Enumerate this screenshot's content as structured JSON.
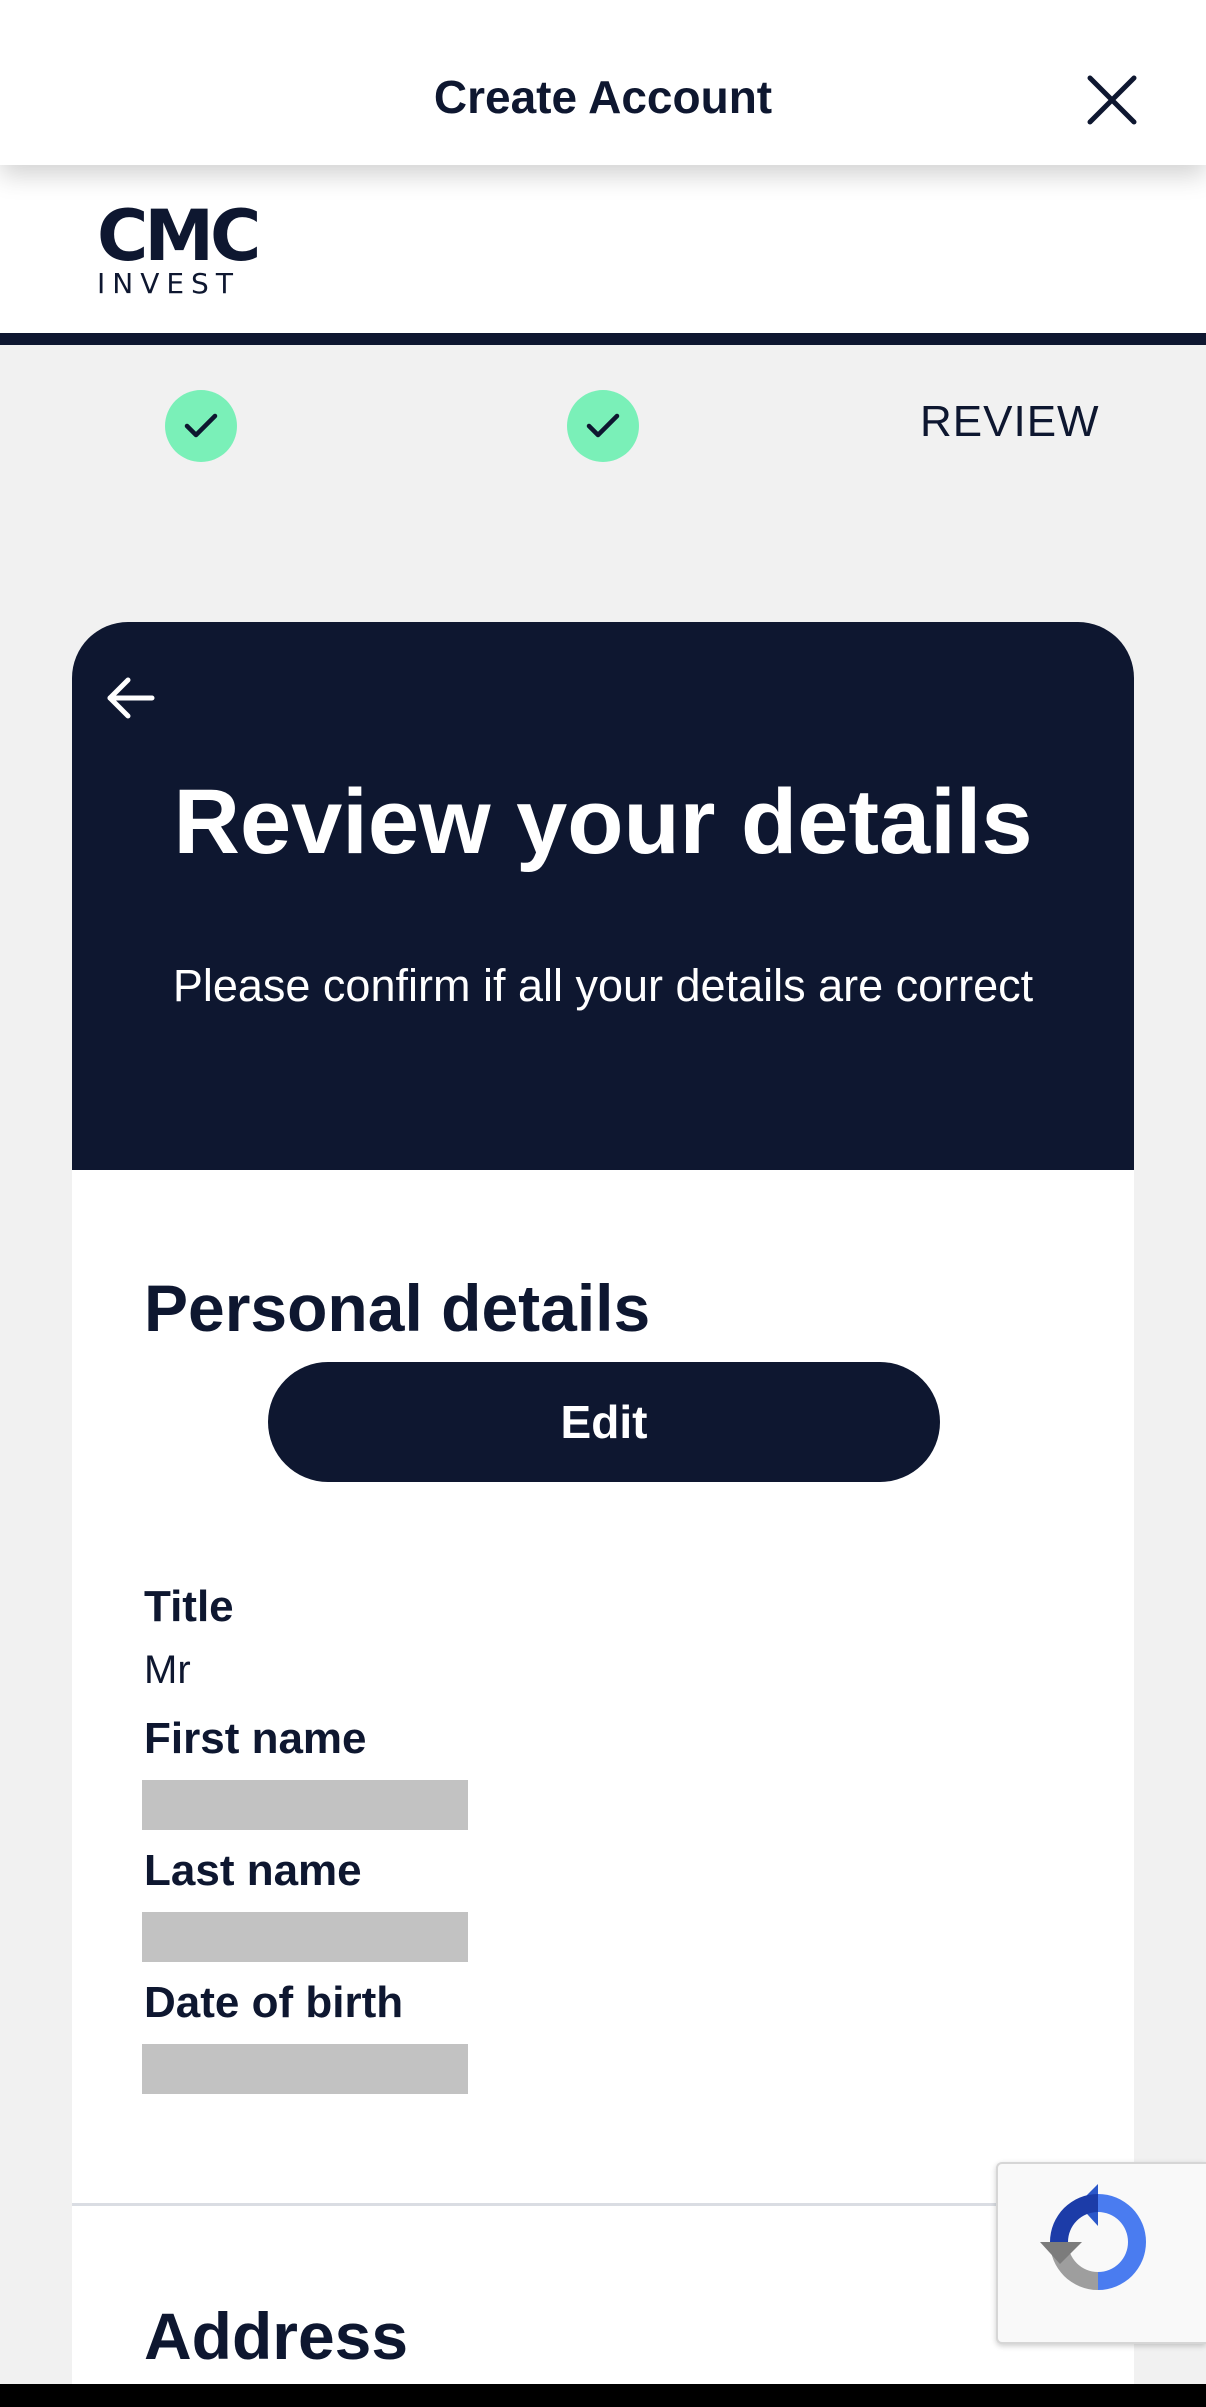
{
  "header": {
    "title": "Create Account",
    "close_icon": "close-icon"
  },
  "brand": {
    "logo_mark": "CMC",
    "logo_sub": "INVEST"
  },
  "steps": {
    "completed": [
      {
        "icon": "check-icon",
        "color": "#7af0b8"
      },
      {
        "icon": "check-icon",
        "color": "#7af0b8"
      }
    ],
    "current_label": "REVIEW"
  },
  "card": {
    "back_icon": "arrow-left-icon",
    "title": "Review your details",
    "subtitle": "Please confirm if all your details are correct"
  },
  "personal_details": {
    "title": "Personal details",
    "edit_label": "Edit",
    "fields": [
      {
        "label": "Title",
        "value": "Mr"
      },
      {
        "label": "First name",
        "value": ""
      },
      {
        "label": "Last name",
        "value": ""
      },
      {
        "label": "Date of birth",
        "value": ""
      }
    ]
  },
  "address": {
    "title": "Address"
  },
  "recaptcha": {
    "icon": "recaptcha-icon"
  },
  "colors": {
    "navy": "#0e1730",
    "success_green": "#7af0b8",
    "background": "#f1f1f1"
  }
}
